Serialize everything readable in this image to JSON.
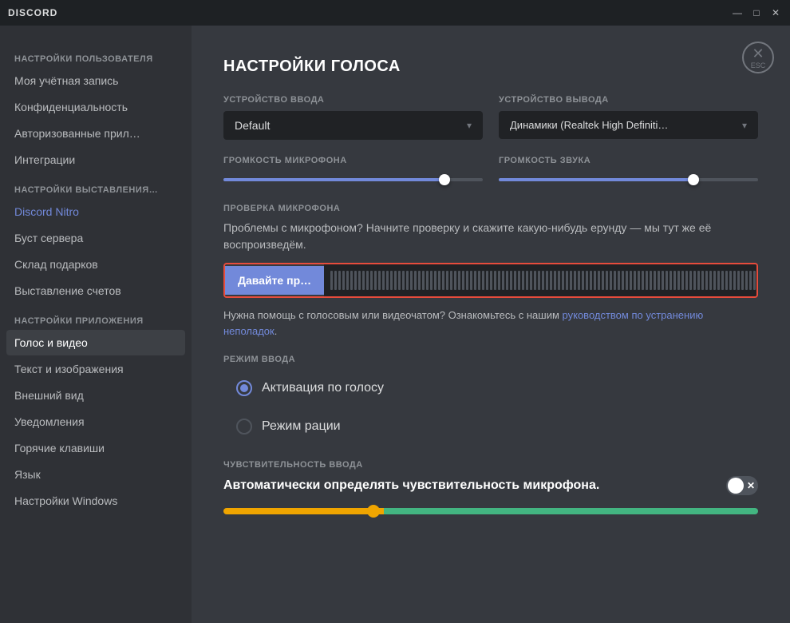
{
  "titlebar": {
    "title": "DISCORD",
    "minimize": "—",
    "maximize": "□",
    "close": "✕"
  },
  "esc_btn": {
    "x": "✕",
    "label": "ESC"
  },
  "sidebar": {
    "user_settings_label": "НАСТРОЙКИ ПОЛЬЗОВАТЕЛЯ",
    "items_user": [
      {
        "id": "account",
        "label": "Моя учётная запись",
        "active": false
      },
      {
        "id": "privacy",
        "label": "Конфиденциальность",
        "active": false
      },
      {
        "id": "apps",
        "label": "Авторизованные прил…",
        "active": false
      },
      {
        "id": "integrations",
        "label": "Интеграции",
        "active": false
      }
    ],
    "billing_settings_label": "НАСТРОЙКИ ВЫСТАВЛЕНИЯ…",
    "items_billing": [
      {
        "id": "nitro",
        "label": "Discord Nitro",
        "accent": true,
        "active": false
      },
      {
        "id": "boost",
        "label": "Буст сервера",
        "active": false
      },
      {
        "id": "gifts",
        "label": "Склад подарков",
        "active": false
      },
      {
        "id": "billing",
        "label": "Выставление счетов",
        "active": false
      }
    ],
    "app_settings_label": "НАСТРОЙКИ ПРИЛОЖЕНИЯ",
    "items_app": [
      {
        "id": "voice",
        "label": "Голос и видео",
        "active": true
      },
      {
        "id": "text",
        "label": "Текст и изображения",
        "active": false
      },
      {
        "id": "appearance",
        "label": "Внешний вид",
        "active": false
      },
      {
        "id": "notifications",
        "label": "Уведомления",
        "active": false
      },
      {
        "id": "hotkeys",
        "label": "Горячие клавиши",
        "active": false
      },
      {
        "id": "language",
        "label": "Язык",
        "active": false
      },
      {
        "id": "windows",
        "label": "Настройки Windows",
        "active": false
      },
      {
        "id": "more",
        "label": "...",
        "active": false
      }
    ]
  },
  "content": {
    "page_title": "НАСТРОЙКИ ГОЛОСА",
    "input_device_label": "УСТРОЙСТВО ВВОДА",
    "input_device_value": "Default",
    "output_device_label": "УСТРОЙСТВО ВЫВОДА",
    "output_device_value": "Динамики (Realtek High Definition А",
    "mic_volume_label": "ГРОМКОСТЬ МИКРОФОНА",
    "sound_volume_label": "ГРОМКОСТЬ ЗВУКА",
    "mic_check_label": "ПРОВЕРКА МИКРОФОНА",
    "mic_check_desc": "Проблемы с микрофоном? Начните проверку и скажите какую-нибудь ерунду — мы тут же её воспроизведём.",
    "mic_check_btn": "Давайте пр…",
    "help_text_before": "Нужна помощь с голосовым или видеочатом? Ознакомьтесь с нашим ",
    "help_link": "руководством по устранению неполадок",
    "help_text_after": ".",
    "input_mode_label": "РЕЖИМ ВВОДА",
    "voice_activation_label": "Активация по голосу",
    "push_to_talk_label": "Режим рации",
    "sensitivity_label": "ЧУВСТВИТЕЛЬНОСТЬ ВВОДА",
    "auto_sensitivity_label": "Автоматически определять чувствительность микрофона."
  },
  "colors": {
    "accent": "#7289da",
    "active_bg": "#3d4045",
    "danger": "#e74c3c",
    "success": "#43b581",
    "warning": "#f0a500",
    "sidebar_bg": "#2f3136",
    "content_bg": "#36393f",
    "dark_bg": "#202225"
  }
}
